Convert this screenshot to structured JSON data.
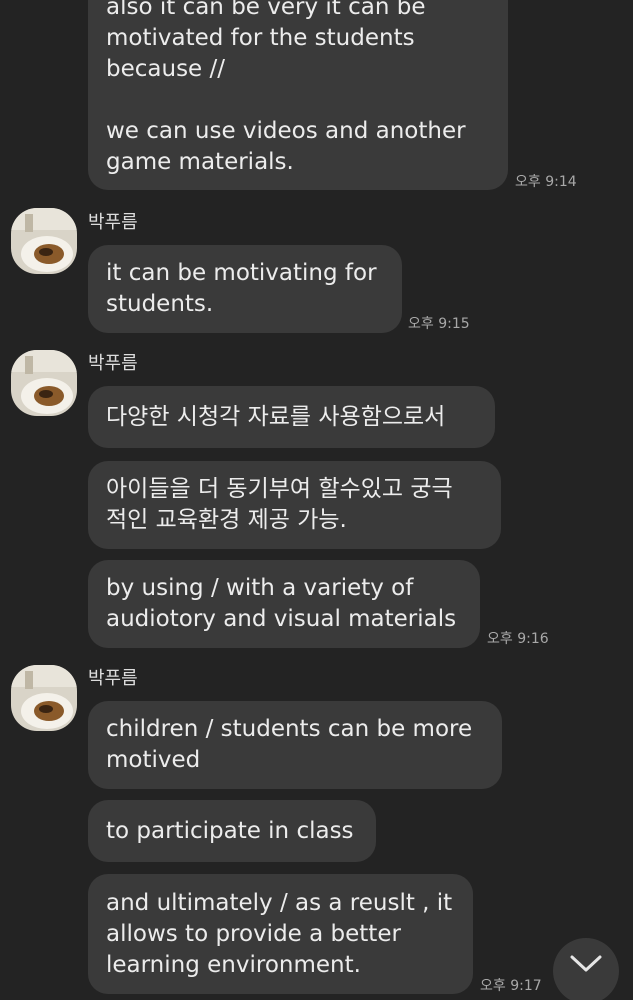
{
  "messages": [
    {
      "text": "also it can be very it can be\nmotivated for the students\nbecause //\n\nwe can use videos and another\ngame materials.",
      "time": "오후 9:14"
    },
    {
      "sender": "박푸름",
      "text": "it can be motivating for\nstudents.",
      "time": "오후 9:15"
    },
    {
      "sender": "박푸름",
      "bubbles": [
        "다양한 시청각 자료를 사용함으로서",
        "아이들을 더 동기부여 할수있고 궁극\n적인 교육환경 제공 가능.",
        "by using / with a variety of\naudiotory and visual materials"
      ],
      "time": "오후 9:16"
    },
    {
      "sender": "박푸름",
      "bubbles": [
        "children / students can be more\nmotived",
        "to participate in class",
        "and ultimately / as a reuslt , it\nallows to provide a better\nlearning environment."
      ],
      "time": "오후 9:17"
    }
  ],
  "icons": {
    "avatar": "profile-photo-food-icon",
    "scroll_down": "chevron-down-icon"
  },
  "colors": {
    "background": "#232323",
    "bubble": "#3a3a3a",
    "text": "#ececec",
    "time": "#a8a8a8"
  }
}
